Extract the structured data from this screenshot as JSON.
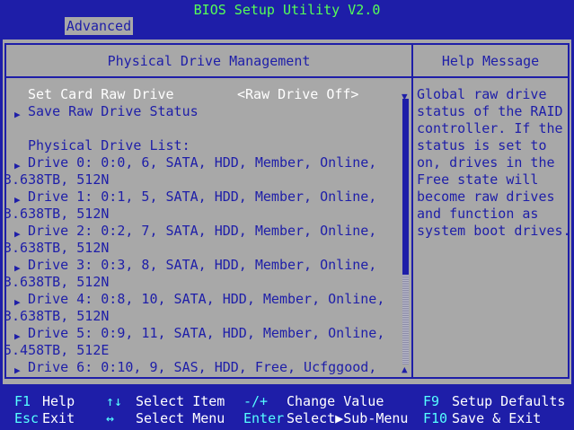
{
  "app_title": "BIOS Setup Utility V2.0",
  "active_tab": "Advanced",
  "main": {
    "header": "Physical Drive Management",
    "set_card_raw_drive": {
      "label": "Set Card Raw Drive",
      "value": "<Raw Drive Off>"
    },
    "save_raw_drive_status": "Save Raw Drive Status",
    "list_title": "Physical Drive List:",
    "drives": [
      {
        "line1": "Drive 0: 0:0, 6, SATA, HDD, Member, Online,",
        "line2": "3.638TB, 512N"
      },
      {
        "line1": "Drive 1: 0:1, 5, SATA, HDD, Member, Online,",
        "line2": "3.638TB, 512N"
      },
      {
        "line1": "Drive 2: 0:2, 7, SATA, HDD, Member, Online,",
        "line2": "3.638TB, 512N"
      },
      {
        "line1": "Drive 3: 0:3, 8, SATA, HDD, Member, Online,",
        "line2": "3.638TB, 512N"
      },
      {
        "line1": "Drive 4: 0:8, 10, SATA, HDD, Member, Online,",
        "line2": "3.638TB, 512N"
      },
      {
        "line1": "Drive 5: 0:9, 11, SATA, HDD, Member, Online,",
        "line2": "5.458TB, 512E"
      },
      {
        "line1": "Drive 6: 0:10, 9, SAS, HDD, Free, Ucfggood,",
        "line2": ""
      }
    ]
  },
  "help": {
    "header": "Help Message",
    "lines": [
      "Global raw drive",
      "status of the RAID",
      "controller. If the",
      "status is set to",
      "on, drives in the",
      "Free state will",
      "become raw drives",
      "and function as",
      "system boot drives."
    ]
  },
  "footer": {
    "f1_key": "F1",
    "f1_desc": "Help",
    "esc_key": "Esc",
    "esc_desc": "Exit",
    "updown_key": "↑↓",
    "updown_desc": "Select Item",
    "leftright_key": "↔",
    "leftright_desc": "Select Menu",
    "plusminus_key": "-/+",
    "plusminus_desc": "Change Value",
    "enter_key": "Enter",
    "enter_desc": "Select▶Sub-Menu",
    "f9_key": "F9",
    "f9_desc": "Setup Defaults",
    "f10_key": "F10",
    "f10_desc": "Save & Exit"
  },
  "colors": {
    "background": "#1e1ea8",
    "panel": "#a8a8a8",
    "title": "#56ff56",
    "selected_text": "#ffffff",
    "footer_key": "#56ffff"
  }
}
